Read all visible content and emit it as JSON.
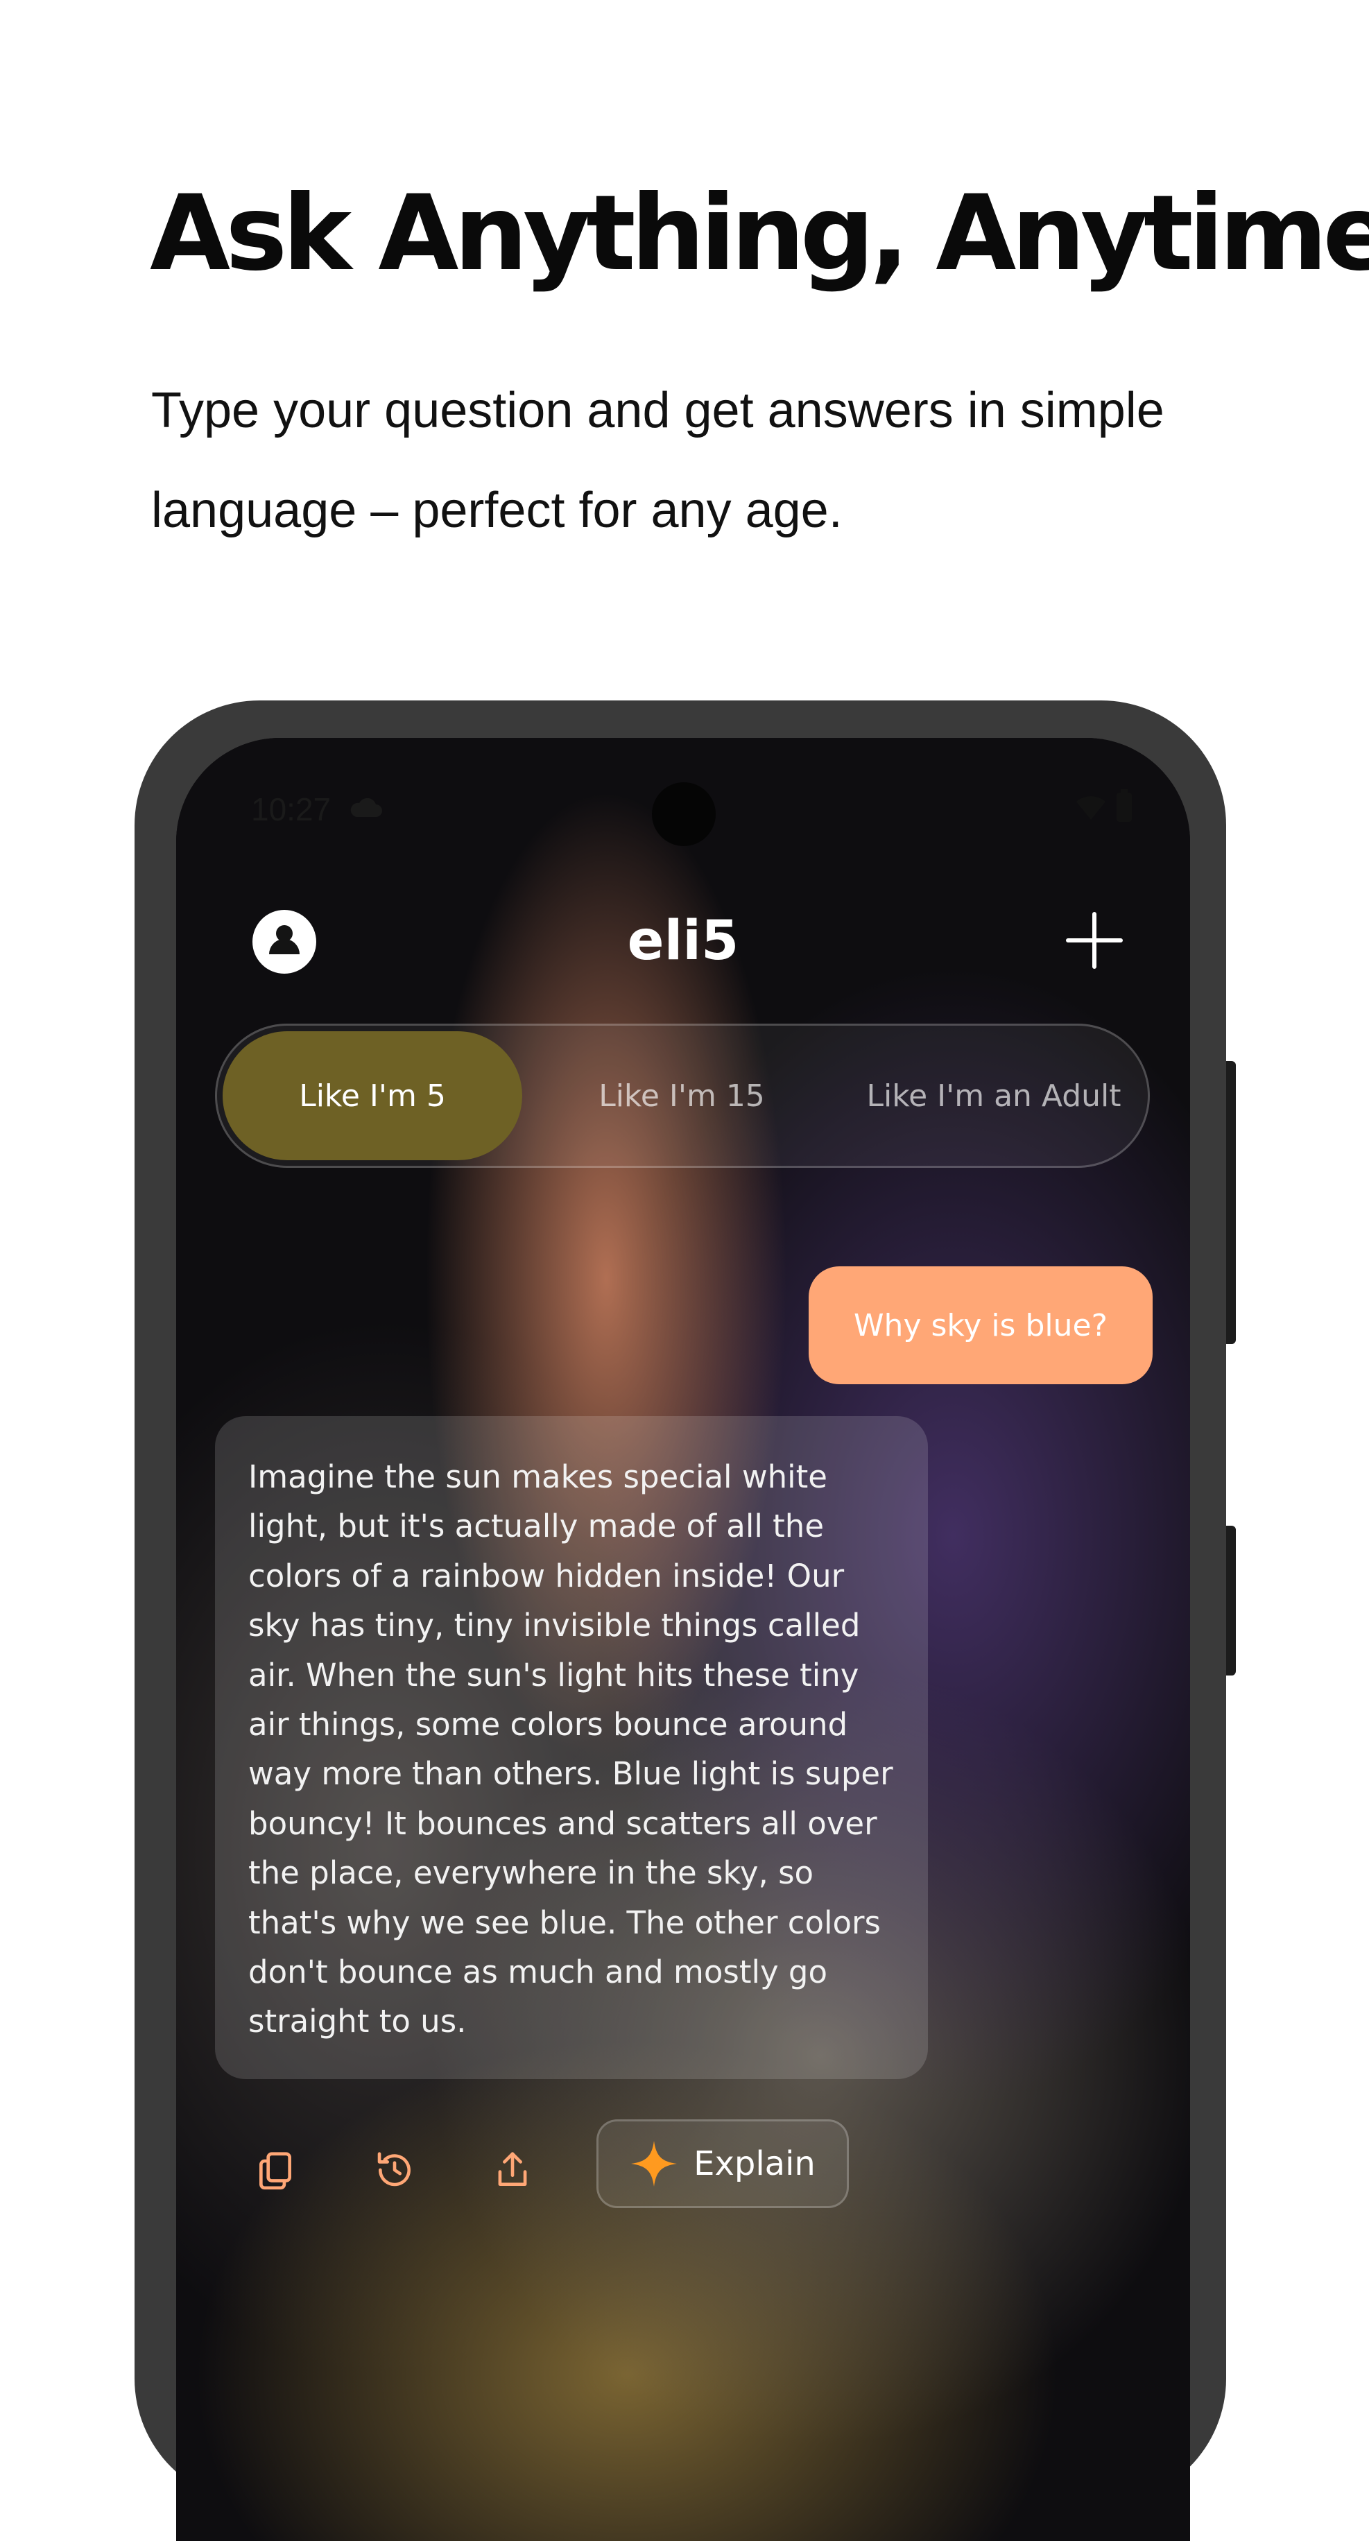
{
  "header": {
    "headline": "Ask Anything, Anytime",
    "subheadline": "Type your question and get answers in simple language – perfect for any age."
  },
  "status_bar": {
    "time": "10:27",
    "icons": [
      "cloud-icon",
      "wifi-icon",
      "battery-icon"
    ]
  },
  "app_bar": {
    "title": "eli5",
    "left_icon": "avatar-icon",
    "right_icon": "plus-icon"
  },
  "modes": {
    "selected": "Like I'm 5",
    "items": [
      "Like I'm 5",
      "Like I'm 15",
      "Like I'm an Adult"
    ]
  },
  "chat": {
    "question": "Why sky is blue?",
    "answer": "Imagine the sun makes special white light, but it's actually made of all the colors of a rainbow hidden inside! Our sky has tiny, tiny invisible things called air. When the sun's light hits these tiny air things, some colors bounce around way more than others. Blue light is super bouncy! It bounces and scatters all over the place, everywhere in the sky, so that's why we see blue. The other colors don't bounce as much and mostly go straight to us."
  },
  "actions": {
    "icons": [
      "copy-icon",
      "regenerate-icon",
      "share-icon"
    ],
    "explain_label": "Explain"
  },
  "colors": {
    "accent": "#FFA776",
    "selected_mode": "#6E6125",
    "sparkle": "#FF9A1F",
    "frame": "#3A3A3A"
  }
}
